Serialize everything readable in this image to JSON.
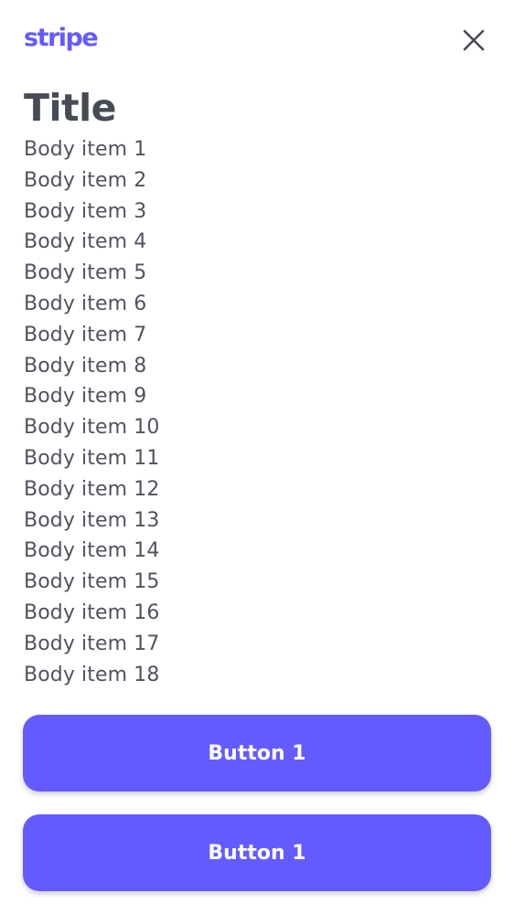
{
  "brand": {
    "logo_text": "stripe",
    "accent_color": "#635bff"
  },
  "header": {
    "close_icon": "close-icon"
  },
  "content": {
    "title": "Title",
    "body_items": [
      "Body item 1",
      "Body item 2",
      "Body item 3",
      "Body item 4",
      "Body item 5",
      "Body item 6",
      "Body item 7",
      "Body item 8",
      "Body item 9",
      "Body item 10",
      "Body item 11",
      "Body item 12",
      "Body item 13",
      "Body item 14",
      "Body item 15",
      "Body item 16",
      "Body item 17",
      "Body item 18"
    ]
  },
  "buttons": [
    {
      "label": "Button 1",
      "color": "#645bff"
    },
    {
      "label": "Button 1",
      "color": "#645bff"
    }
  ]
}
